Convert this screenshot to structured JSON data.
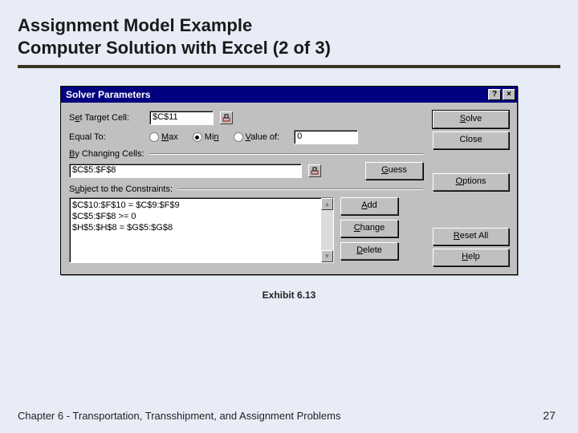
{
  "slide": {
    "title_line1": "Assignment Model Example",
    "title_line2": "Computer Solution with Excel (2 of 3)",
    "exhibit": "Exhibit 6.13",
    "footer_chapter": "Chapter 6 - Transportation, Transshipment, and Assignment Problems",
    "page_number": "27"
  },
  "dialog": {
    "title": "Solver Parameters",
    "help_btn": "?",
    "close_btn": "×",
    "labels": {
      "set_target_cell": "Set Target Cell:",
      "equal_to": "Equal To:",
      "max": "Max",
      "min": "Min",
      "value_of": "Value of:",
      "by_changing": "By Changing Cells:",
      "subject_to": "Subject to the Constraints:"
    },
    "target_cell": "$C$11",
    "equal_to_selected": "min",
    "value_of": "0",
    "changing_cells": "$C$5:$F$8",
    "constraints": [
      "$C$10:$F$10 = $C$9:$F$9",
      "$C$5:$F$8 >= 0",
      "$H$5:$H$8 = $G$5:$G$8"
    ],
    "buttons": {
      "solve": "Solve",
      "close": "Close",
      "options": "Options",
      "reset_all": "Reset All",
      "help": "Help",
      "guess": "Guess",
      "add": "Add",
      "change": "Change",
      "delete": "Delete"
    }
  }
}
